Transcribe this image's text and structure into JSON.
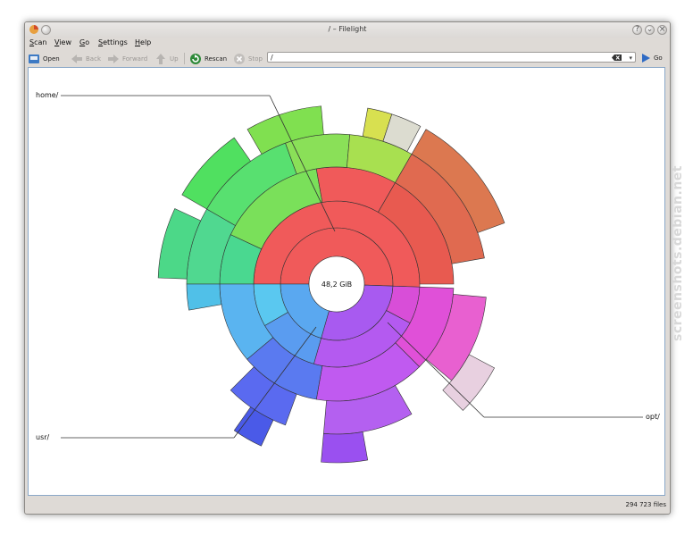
{
  "window": {
    "title": "/ – Filelight"
  },
  "menu": {
    "items": [
      {
        "pre": "",
        "u": "S",
        "post": "can"
      },
      {
        "pre": "",
        "u": "V",
        "post": "iew"
      },
      {
        "pre": "",
        "u": "G",
        "post": "o"
      },
      {
        "pre": "",
        "u": "S",
        "post": "ettings"
      },
      {
        "pre": "",
        "u": "H",
        "post": "elp"
      }
    ]
  },
  "toolbar": {
    "open": "Open",
    "back": "Back",
    "forward": "Forward",
    "up": "Up",
    "rescan": "Rescan",
    "stop": "Stop",
    "path": "/",
    "go": "Go"
  },
  "chart": {
    "center_label": "48,2 GiB",
    "labels": {
      "home": "home/",
      "usr": "usr/",
      "opt": "opt/"
    }
  },
  "status": {
    "files": "294 723 files"
  },
  "watermark": "screenshots.debian.net",
  "icons": [
    "filelight-app-icon",
    "open-icon",
    "back-icon",
    "forward-icon",
    "up-icon",
    "rescan-icon",
    "stop-icon",
    "clear-icon",
    "go-icon"
  ]
}
